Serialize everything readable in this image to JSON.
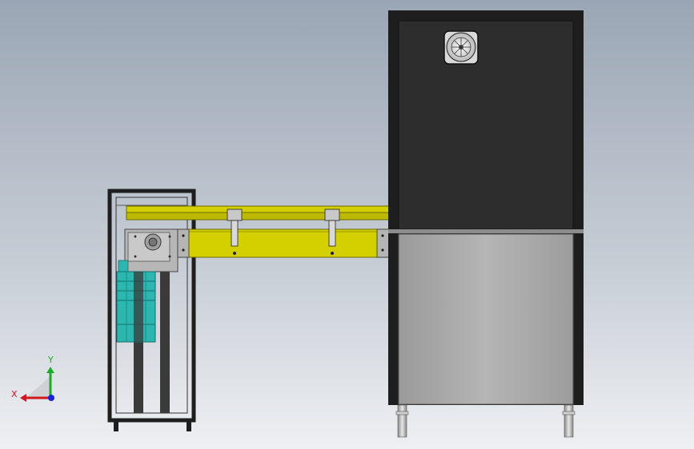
{
  "viewport": {
    "background_top": "#9aa6b5",
    "background_bottom": "#e8eaee"
  },
  "triad": {
    "x_label": "X",
    "y_label": "Y",
    "x_color": "#d0181e",
    "y_color": "#1faa2a",
    "z_color": "#1d22d6"
  },
  "colors": {
    "frame_dark": "#1e1e1e",
    "rail_yellow": "#d4d000",
    "motor_teal": "#2bb6b0",
    "cabinet_dark": "#2a2a2a",
    "cabinet_gray": "#a8a8a8"
  }
}
